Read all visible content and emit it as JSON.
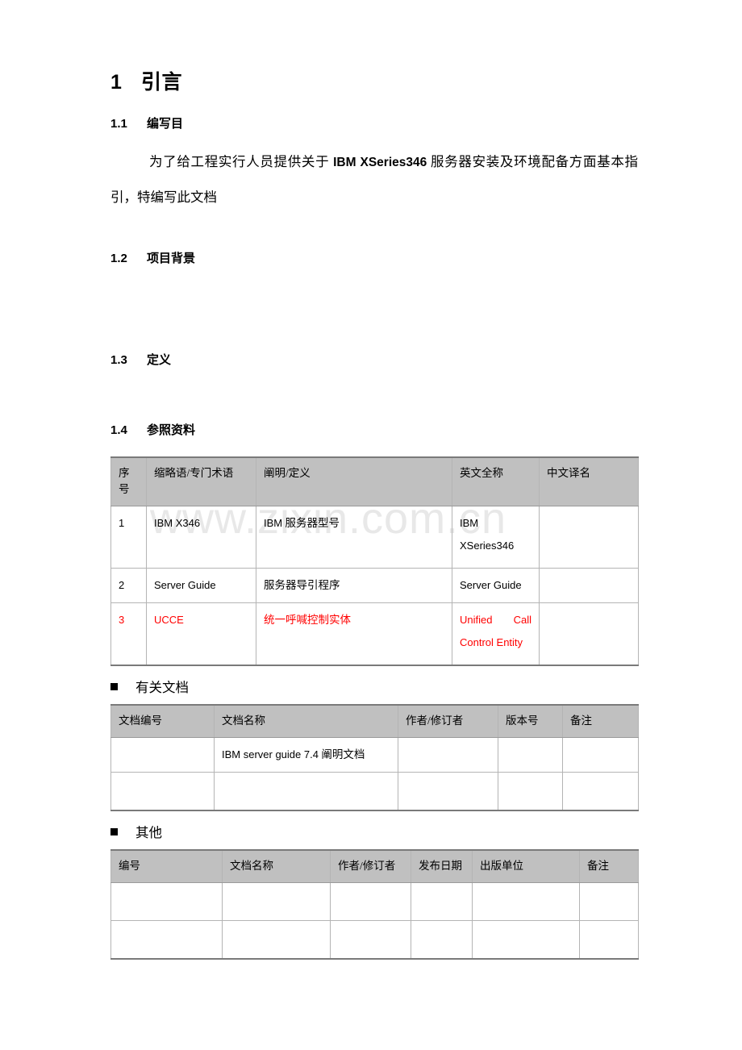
{
  "document": {
    "watermark": "www.zixin.com.cn"
  },
  "headings": {
    "h1": {
      "number": "1",
      "title": "引言"
    },
    "s11": {
      "number": "1.1",
      "title": "编写目"
    },
    "s12": {
      "number": "1.2",
      "title": "项目背景"
    },
    "s13": {
      "number": "1.3",
      "title": "定义"
    },
    "s14": {
      "number": "1.4",
      "title": "参照资料"
    }
  },
  "paragraph_11": {
    "part1": "为了给工程实行人员提供关于 ",
    "latin": "IBM XSeries346",
    "part2": " 服务器安装及环境配备方面基本指引，特编写此文档"
  },
  "table_definitions": {
    "headers": [
      "序号",
      "缩略语/专门术语",
      "阐明/定义",
      "英文全称",
      "中文译名"
    ],
    "rows": [
      {
        "seq": "1",
        "abbr": "IBM X346",
        "desc_latin": "IBM",
        "desc_cjk": " 服务器型号",
        "english": "IBM XSeries346",
        "chinese": "",
        "red": false
      },
      {
        "seq": "2",
        "abbr": "Server Guide",
        "desc_latin": "",
        "desc_cjk": "服务器导引程序",
        "english": "Server Guide",
        "chinese": "",
        "red": false
      },
      {
        "seq": "3",
        "abbr": "UCCE",
        "desc_latin": "",
        "desc_cjk": "统一呼喊控制实体",
        "english": "Unified Call Control Entity",
        "chinese": "",
        "red": true
      }
    ]
  },
  "section_related": {
    "bullet_label": "有关文档",
    "headers": [
      "文档编号",
      "文档名称",
      "作者/修订者",
      "版本号",
      "备注"
    ],
    "rows": [
      {
        "doc_no": "",
        "name_latin": "IBM server guide 7.4",
        "name_cjk": " 阐明文档",
        "author": "",
        "version": "",
        "remark": ""
      },
      {
        "doc_no": "",
        "name_latin": "",
        "name_cjk": "",
        "author": "",
        "version": "",
        "remark": ""
      }
    ]
  },
  "section_other": {
    "bullet_label": "其他",
    "headers": [
      "编号",
      "文档名称",
      "作者/修订者",
      "发布日期",
      "出版单位",
      "备注"
    ],
    "rows": [
      {
        "no": "",
        "name": "",
        "author": "",
        "date": "",
        "publisher": "",
        "remark": ""
      },
      {
        "no": "",
        "name": "",
        "author": "",
        "date": "",
        "publisher": "",
        "remark": ""
      }
    ]
  }
}
